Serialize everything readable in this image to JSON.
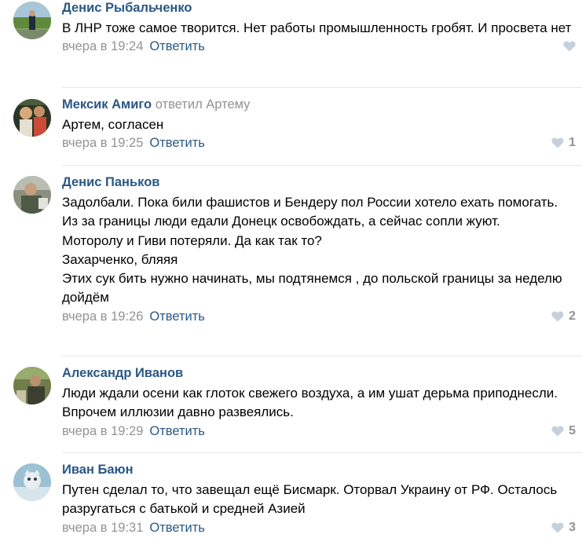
{
  "comments": [
    {
      "author": "Денис Рыбальченко",
      "reply_to": "",
      "lines": [
        "В ЛНР тоже самое творится. Нет работы промышленность гробят. И просвета нет"
      ],
      "date": "вчера в 19:24",
      "reply_label": "Ответить",
      "likes": ""
    },
    {
      "author": "Мексик Амиго",
      "reply_to": "ответил Артему",
      "lines": [
        "Артем, согласен"
      ],
      "date": "вчера в 19:25",
      "reply_label": "Ответить",
      "likes": "1"
    },
    {
      "author": "Денис Паньков",
      "reply_to": "",
      "lines": [
        "Задолбали. Пока били фашистов и Бендеру пол России хотело ехать помогать. Из за границы люди едали Донецк освобождать, а сейчас сопли жуют.",
        "Моторолу и Гиви потеряли. Да как так то?",
        "Захарченко, бляяя",
        "Этих сук бить нужно начинать, мы подтянемся , до польской границы за неделю дойдём"
      ],
      "date": "вчера в 19:26",
      "reply_label": "Ответить",
      "likes": "2"
    },
    {
      "author": "Александр Иванов",
      "reply_to": "",
      "lines": [
        "Люди ждали осени как глоток свежего воздуха, а им ушат дерьма приподнесли. Впрочем иллюзии давно развеялись."
      ],
      "date": "вчера в 19:29",
      "reply_label": "Ответить",
      "likes": "5"
    },
    {
      "author": "Иван Баюн",
      "reply_to": "",
      "lines": [
        "Путен сделал то, что завещал ещё Бисмарк. Оторвал Украину от РФ. Осталось разругаться с батькой и средней Азией"
      ],
      "date": "вчера в 19:31",
      "reply_label": "Ответить",
      "likes": "3"
    }
  ],
  "colors": {
    "author": "#2a5885",
    "muted": "#939393",
    "separator": "#e7e8ec",
    "like_icon": "#c5d0db"
  },
  "icons": {
    "like": "heart-icon"
  }
}
